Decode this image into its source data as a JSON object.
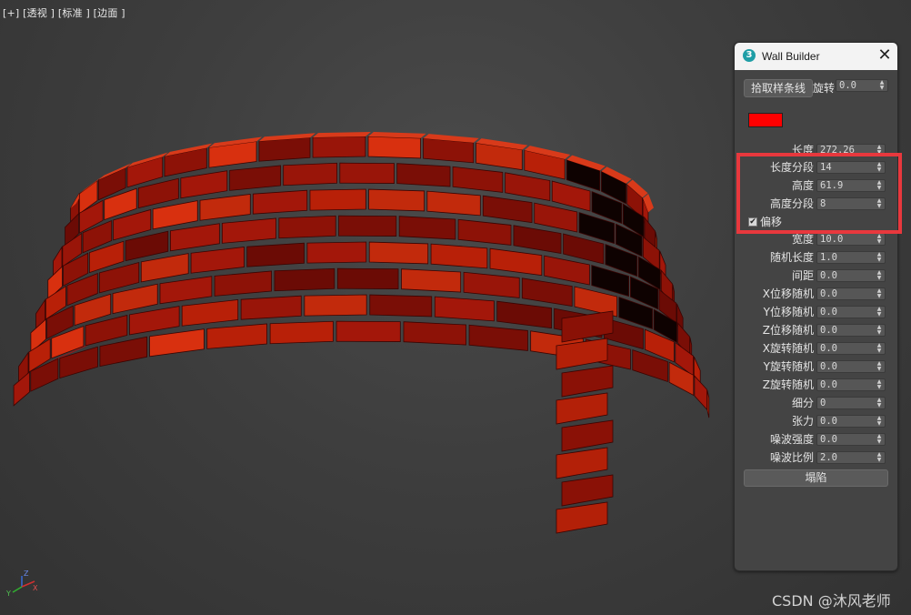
{
  "viewport": {
    "label": "[+] [透视 ] [标准 ] [边面 ]"
  },
  "gizmo": {
    "axis_z": "Z",
    "axis_y": "Y",
    "axis_x": "X"
  },
  "panel": {
    "title": "Wall Builder",
    "app_icon_text": "3",
    "pick_spline_label": "拾取样条线",
    "rotate_label": "旋转",
    "rotate_value": "0.0",
    "wall_color": "#ff0000",
    "length_label": "长度",
    "length_value": "272.26",
    "params": [
      {
        "label": "长度分段",
        "value": "14"
      },
      {
        "label": "高度",
        "value": "61.9"
      },
      {
        "label": "高度分段",
        "value": "8"
      }
    ],
    "offset_label": "偏移",
    "offset_checked": true,
    "params2": [
      {
        "label": "宽度",
        "value": "10.0"
      },
      {
        "label": "随机长度",
        "value": "1.0"
      },
      {
        "label": "间距",
        "value": "0.0"
      },
      {
        "label": "X位移随机",
        "value": "0.0"
      },
      {
        "label": "Y位移随机",
        "value": "0.0"
      },
      {
        "label": "Z位移随机",
        "value": "0.0"
      },
      {
        "label": "X旋转随机",
        "value": "0.0"
      },
      {
        "label": "Y旋转随机",
        "value": "0.0"
      },
      {
        "label": "Z旋转随机",
        "value": "0.0"
      },
      {
        "label": "细分",
        "value": "0"
      },
      {
        "label": "张力",
        "value": "0.0"
      },
      {
        "label": "噪波强度",
        "value": "0.0"
      },
      {
        "label": "噪波比例",
        "value": "2.0"
      }
    ],
    "collapse_label": "塌陷"
  },
  "highlight_color": "#e8383d",
  "watermark": "CSDN @沐风老师"
}
